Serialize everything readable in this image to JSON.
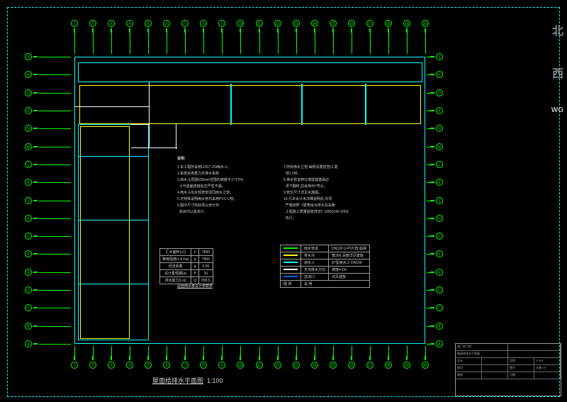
{
  "drawing": {
    "title": "屋面给排水平面图",
    "scale": "1:100",
    "bottom_label": "屋面给排水平面图"
  },
  "grid": {
    "h_axes": [
      "A",
      "B",
      "C",
      "D",
      "E",
      "F",
      "G",
      "H",
      "J",
      "K",
      "L",
      "M",
      "N",
      "P",
      "Q",
      "R",
      "S"
    ],
    "v_axes": [
      "1",
      "2",
      "3",
      "4",
      "5",
      "6",
      "7",
      "8",
      "9",
      "10",
      "11",
      "12",
      "13",
      "14",
      "15",
      "16",
      "17",
      "18",
      "19",
      "20"
    ]
  },
  "notes": {
    "heading": "说明:",
    "left": "1.本工程所采用LDG7-2/3雨水斗。\n2.系统采用重力外排水系统\n3.雨水斗周围500mm范围内坡度不小于5%,\n  斗与屋面连接处应严密不漏。\n4.雨水斗出水短管管径同雨水立管。\n5.无特殊说明雨水管均采用PVC-U管。\n6.图中尺寸除标高以米计外,\n  其余均以毫米计。",
    "right": "7.所有雨水立管,每根设置检查口,距\n  地1.0米。\n8.排水管道穿过墙壁或基础必\n  须下翻时,应采用45°弯头。\n9.管位尺寸详见水施图。\n10.凡本设计未详细说明处,均须\n  严格按照《建筑给水排水及采暖\n  工程施工质量验收规范》GB50242-2002\n  执行。"
  },
  "param_table": {
    "title": "屋面雨水量设计参数表",
    "rows": [
      [
        "汇水面积(㎡)",
        "F",
        "7850"
      ],
      [
        "降雨强度(L/s·ha)",
        "q",
        "7900"
      ],
      [
        "径流系数",
        "φ",
        "0.90"
      ],
      [
        "设计重现期(a)",
        "P",
        "10"
      ],
      [
        "排水能力(L/s)",
        "Q",
        "555.5"
      ]
    ]
  },
  "legend": {
    "header": [
      "图例",
      "名称",
      "备注"
    ],
    "rows": [
      {
        "color": "#0f0",
        "name": "雨水管道",
        "note": "DN100 U-PVC管,粘接"
      },
      {
        "color": "#ff0",
        "name": "排水沟",
        "note": "宽300,深度详见建施"
      },
      {
        "color": "#0ff",
        "name": "雨水斗",
        "note": "87型雨水斗 DN100"
      },
      {
        "color": "#fff",
        "name": "天沟排水方向",
        "note": "坡度i=1%"
      },
      {
        "color": "#06f",
        "name": "溢流口",
        "note": "详见建施"
      }
    ],
    "footer": [
      "图 例",
      "说 明"
    ]
  },
  "titleblock": {
    "project": "某厂房工程",
    "drawing_name": "屋面给排水平面图",
    "drawing_no": "水施-03",
    "scale": "1:100",
    "date": "",
    "designer": "",
    "checker": "",
    "approver": ""
  },
  "watermark": {
    "char1": "北",
    "char2": "西",
    "char3": "WG"
  }
}
